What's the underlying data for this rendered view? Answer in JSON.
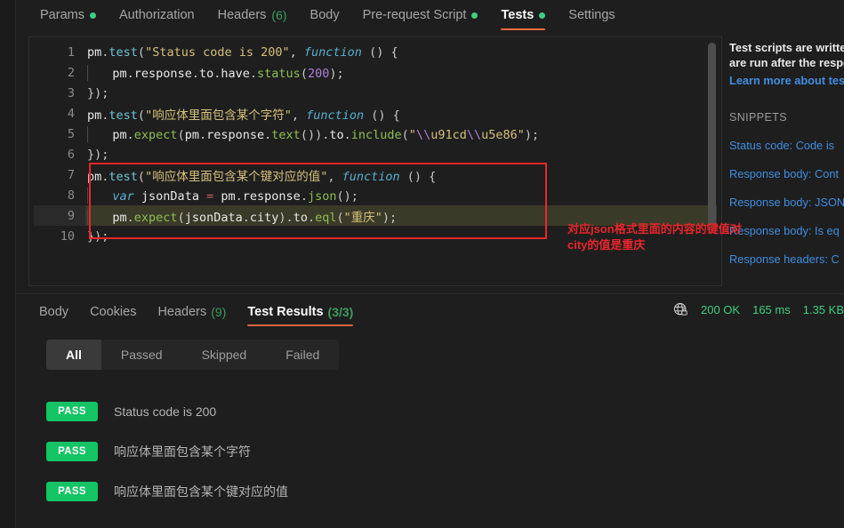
{
  "top_tabs": [
    {
      "label": "Params",
      "dot": true,
      "count": null,
      "active": false
    },
    {
      "label": "Authorization",
      "dot": false,
      "count": null,
      "active": false
    },
    {
      "label": "Headers",
      "dot": false,
      "count": "(6)",
      "active": false
    },
    {
      "label": "Body",
      "dot": false,
      "count": null,
      "active": false
    },
    {
      "label": "Pre-request Script",
      "dot": true,
      "count": null,
      "active": false
    },
    {
      "label": "Tests",
      "dot": true,
      "count": null,
      "active": true
    },
    {
      "label": "Settings",
      "dot": false,
      "count": null,
      "active": false
    }
  ],
  "editor": {
    "lines": [
      {
        "num": "1",
        "active": false
      },
      {
        "num": "2",
        "active": false
      },
      {
        "num": "3",
        "active": false
      },
      {
        "num": "4",
        "active": false
      },
      {
        "num": "5",
        "active": false
      },
      {
        "num": "6",
        "active": false
      },
      {
        "num": "7",
        "active": false
      },
      {
        "num": "8",
        "active": false
      },
      {
        "num": "9",
        "active": true
      },
      {
        "num": "10",
        "active": false
      }
    ],
    "code_text": [
      "pm.test(\"Status code is 200\", function () {",
      "    pm.response.to.have.status(200);",
      "});",
      "pm.test(\"响应体里面包含某个字符\", function () {",
      "    pm.expect(pm.response.text()).to.include(\"\\\\u91cd\\\\u5e86\");",
      "});",
      "pm.test(\"响应体里面包含某个键对应的值\", function () {",
      "    var jsonData = pm.response.json();",
      "    pm.expect(jsonData.city).to.eql(\"重庆\");",
      "});"
    ],
    "annotation": {
      "line1": "对应json格式里面的内容的键值对",
      "line2": "city的值是重庆",
      "color": "#e8262b"
    }
  },
  "snippets": {
    "intro_line1": "Test scripts are writte",
    "intro_line2": "are run after the respo",
    "learn_more": "Learn more about tes",
    "heading": "SNIPPETS",
    "items": [
      "Status code: Code is ",
      "Response body: Cont",
      "Response body: JSON",
      "Response body: Is eq",
      "Response headers: C"
    ]
  },
  "result_tabs": [
    {
      "label": "Body",
      "count": null,
      "active": false
    },
    {
      "label": "Cookies",
      "count": null,
      "active": false
    },
    {
      "label": "Headers",
      "count": "(9)",
      "active": false
    },
    {
      "label": "Test Results",
      "count": "(3/3)",
      "active": true
    }
  ],
  "meta": {
    "icon": "globe-lock-icon",
    "status": "200 OK",
    "time": "165 ms",
    "size": "1.35 KB"
  },
  "filters": [
    {
      "label": "All",
      "active": true
    },
    {
      "label": "Passed",
      "active": false
    },
    {
      "label": "Skipped",
      "active": false
    },
    {
      "label": "Failed",
      "active": false
    }
  ],
  "results": [
    {
      "status": "PASS",
      "label": "Status code is 200"
    },
    {
      "status": "PASS",
      "label": "响应体里面包含某个字符"
    },
    {
      "status": "PASS",
      "label": "响应体里面包含某个键对应的值"
    }
  ],
  "colors": {
    "accent": "#f26b3a",
    "pass_green": "#14c464",
    "link_blue": "#3f8ee0",
    "annotation_red": "#e8262b",
    "status_green": "#3dd07f"
  }
}
